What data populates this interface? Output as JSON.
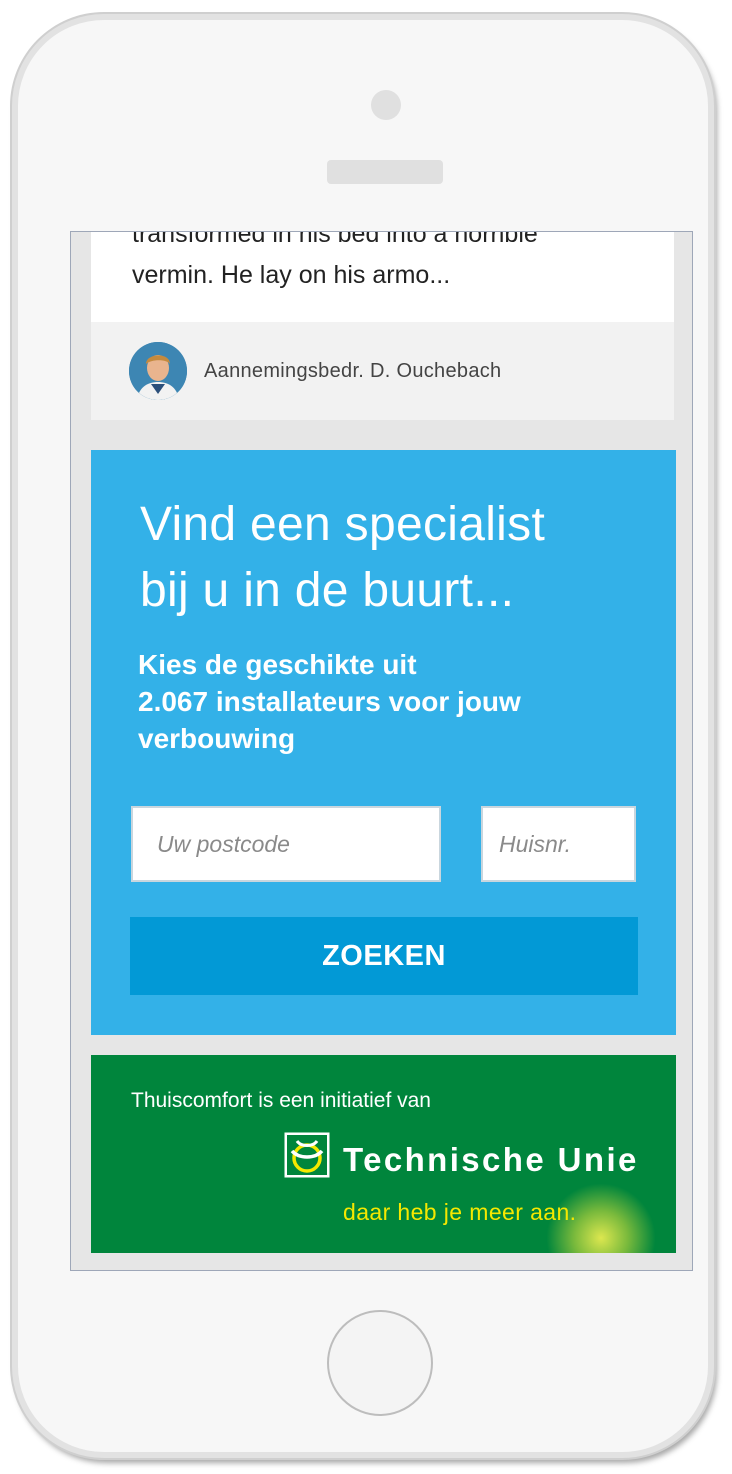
{
  "article": {
    "excerpt": "transformed in his bed into a horrible\nvermin. He lay on his armo...",
    "author": "Aannemingsbedr. D. Ouchebach"
  },
  "search": {
    "headline": "Vind een specialist\nbij u in de buurt...",
    "subline": "Kies de geschikte uit\n2.067 installateurs voor jouw\nverbouwing",
    "postcode_placeholder": "Uw postcode",
    "postcode_value": "",
    "huisnr_placeholder": "Huisnr.",
    "huisnr_value": "",
    "button_label": "ZOEKEN"
  },
  "footer": {
    "initiative_text": "Thuiscomfort is een initiatief van",
    "brand_name": "Technische Unie",
    "brand_slogan": "daar heb je meer aan."
  },
  "colors": {
    "panel_blue": "#33b1e8",
    "button_blue": "#0299d6",
    "footer_green": "#00853c",
    "slogan_yellow": "#f5e800"
  },
  "icons": {
    "avatar": "avatar-photo",
    "brand_logo": "technische-unie-logo-icon"
  }
}
